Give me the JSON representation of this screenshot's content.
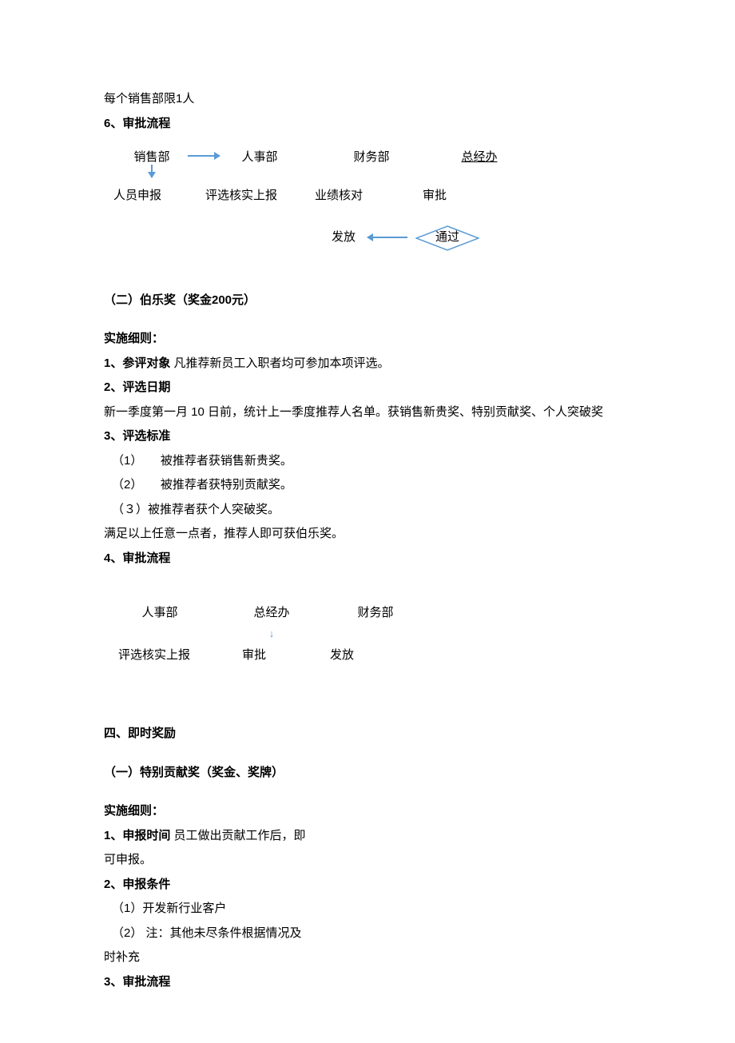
{
  "intro": {
    "limit": "每个销售部限1人",
    "h6": "6、审批流程"
  },
  "flow1": {
    "r1c1": "销售部",
    "r1c2": "人事部",
    "r1c3": "财务部",
    "r1c4": "总经办",
    "r2c1": "人员申报",
    "r2c2": "评选核实上报",
    "r2c3": "业绩核对",
    "r2c4": "审批",
    "r3c3": "发放",
    "r3c4": "通过"
  },
  "bole": {
    "title": "（二）伯乐奖（奖金200元）",
    "rules_label": "实施细则：",
    "i1_label": "1、参评对象",
    "i1_text": " 凡推荐新员工入职者均可参加本项评选。",
    "i2_label": "2、评选日期",
    "i2_text": "新一季度第一月 10 日前，统计上一季度推荐人名单。获销售新贵奖、特别贡献奖、个人突破奖",
    "i3_label": "3、评选标准",
    "c1": "（1）　　被推荐者获销售新贵奖。",
    "c2": "（2）　　被推荐者获特别贡献奖。",
    "c3": "（３）被推荐者获个人突破奖。",
    "cnote": "  满足以上任意一点者，推荐人即可获伯乐奖。",
    "i4_label": "4、审批流程"
  },
  "flow2": {
    "r1c1": "人事部",
    "r1c2": "总经办",
    "r1c3": "财务部",
    "r2c1": "评选核实上报",
    "r2c2": "审批",
    "r2c3": "发放"
  },
  "instant": {
    "title": "四、即时奖励",
    "sub": "（一）特别贡献奖（奖金、奖牌）",
    "rules_label": "实施细则：",
    "i1_label": "1、申报时间",
    "i1_text": " 员工做出贡献工作后，即",
    "i1_text2": "可申报。",
    "i2_label": "2、申报条件",
    "c1": "（1）开发新行业客户",
    "c2": "（2） 注：其他未尽条件根据情况及",
    "c2b": "时补充",
    "i3_label": "3、审批流程"
  }
}
